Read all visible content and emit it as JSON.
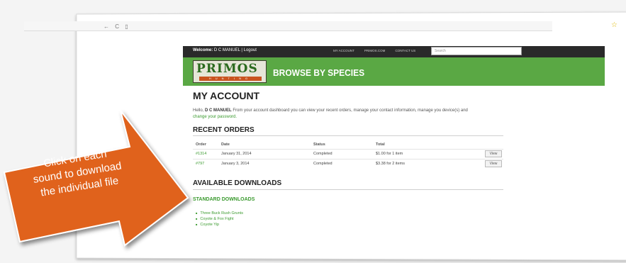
{
  "browser": {
    "nav_glyphs": "← C ▯",
    "star_icon": "star-icon"
  },
  "header": {
    "welcome_label": "Welcome:",
    "user_name": "D C MANUEL",
    "separator": "|",
    "logout": "Logout",
    "links": [
      "MY ACCOUNT",
      "PRIMOS.COM",
      "CONTACT US"
    ],
    "search_placeholder": "Search"
  },
  "brand": {
    "logo_text": "PRIMOS",
    "logo_sub": "HUNTING",
    "browse_label": "BROWSE BY SPECIES"
  },
  "account": {
    "title": "MY ACCOUNT",
    "hello_prefix": "Hello,",
    "hello_name": "D C MANUEL",
    "hello_text": "From your account dashboard you can view your recent orders, manage your contact information, manage you device(s) and",
    "change_password": "change your password."
  },
  "recent_orders": {
    "title": "RECENT ORDERS",
    "columns": [
      "Order",
      "Date",
      "Status",
      "Total"
    ],
    "rows": [
      {
        "order": "#1314",
        "date": "January 31, 2014",
        "status": "Completed",
        "total": "$1.00 for 1 item",
        "action": "View"
      },
      {
        "order": "#797",
        "date": "January 3, 2014",
        "status": "Completed",
        "total": "$3.38 for 2 items",
        "action": "View"
      }
    ]
  },
  "downloads": {
    "title": "AVAILABLE DOWNLOADS",
    "subtitle": "STANDARD DOWNLOADS",
    "items": [
      "Three Buck Rush Grunts",
      "Coyote & Fox Fight",
      "Coyote Yip"
    ]
  },
  "callout": {
    "lines": [
      "Click on each",
      "sound to download",
      "the individual file"
    ],
    "color": "#e0621c"
  },
  "colors": {
    "brand_green": "#5aa844",
    "link_green": "#3a9a2e",
    "topbar": "#2a2a2a"
  }
}
